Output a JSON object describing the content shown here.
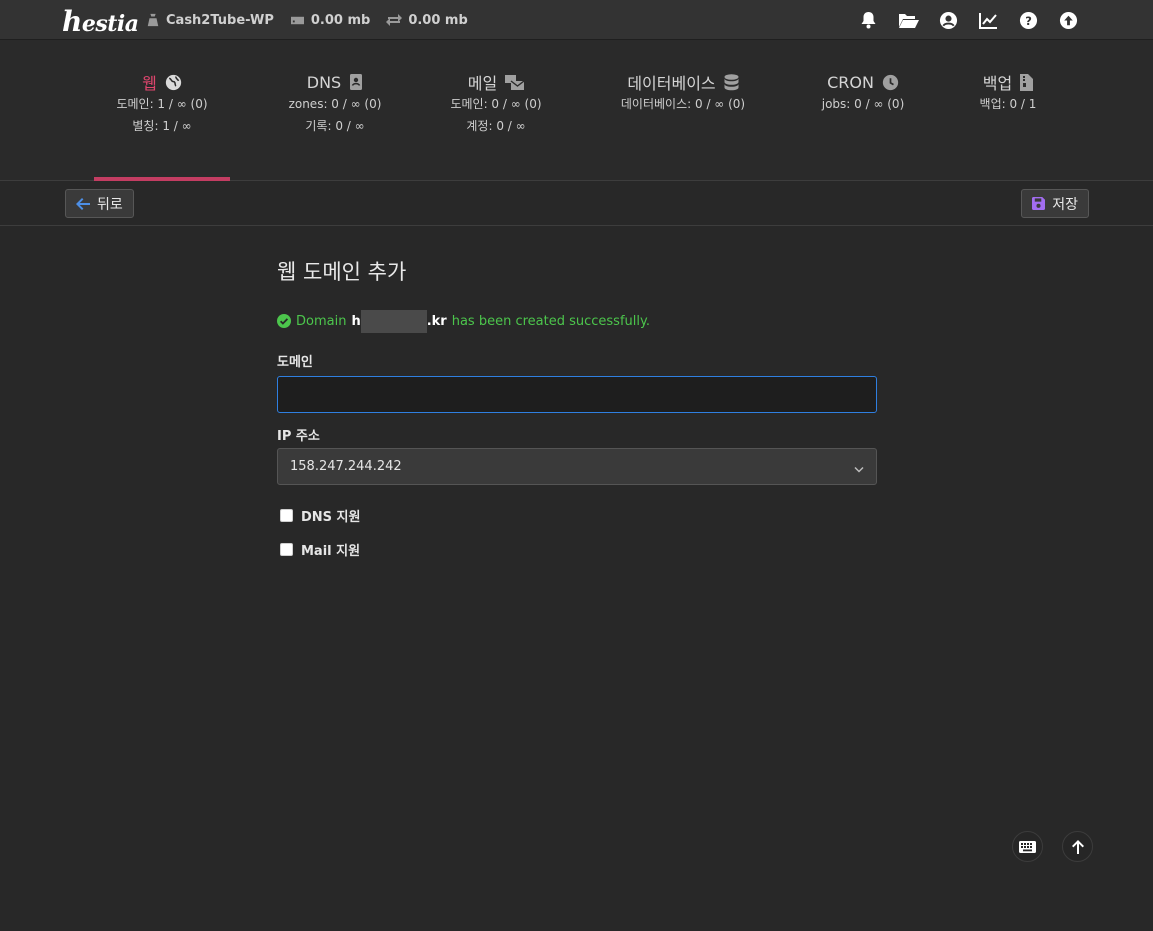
{
  "topbar": {
    "logo_text_initial": "h",
    "logo_text_rest": "estia",
    "user": "Cash2Tube-WP",
    "disk": "0.00 mb",
    "bandwidth": "0.00 mb",
    "icons": [
      "bell-icon",
      "folder-open-icon",
      "user-circle-icon",
      "chart-line-icon",
      "question-circle-icon",
      "arrow-up-circle-icon"
    ]
  },
  "tabs": [
    {
      "title": "웹",
      "icon": "globe-icon",
      "lines": [
        "도메인: 1 / ∞ (0)",
        "별칭: 1 / ∞"
      ],
      "active": true
    },
    {
      "title": "DNS",
      "icon": "address-book-icon",
      "lines": [
        "zones: 0 / ∞ (0)",
        "기록: 0 / ∞"
      ],
      "active": false
    },
    {
      "title": "메일",
      "icon": "mail-bulk-icon",
      "lines": [
        "도메인: 0 / ∞ (0)",
        "계정: 0 / ∞"
      ],
      "active": false
    },
    {
      "title": "데이터베이스",
      "icon": "database-icon",
      "lines": [
        "데이터베이스: 0 / ∞ (0)"
      ],
      "active": false
    },
    {
      "title": "CRON",
      "icon": "clock-icon",
      "lines": [
        "jobs: 0 / ∞ (0)"
      ],
      "active": false
    },
    {
      "title": "백업",
      "icon": "file-archive-icon",
      "lines": [
        "백업: 0 / 1"
      ],
      "active": false
    }
  ],
  "toolbar": {
    "back_label": "뒤로",
    "save_label": "저장"
  },
  "form": {
    "title": "웹 도메인 추가",
    "alert": {
      "prefix": "Domain",
      "domain_start": "h",
      "domain_end": ".kr",
      "suffix": "has been created successfully."
    },
    "domain_label": "도메인",
    "domain_value": "",
    "ip_label": "IP 주소",
    "ip_value": "158.247.244.242",
    "dns_support_label": "DNS 지원",
    "mail_support_label": "Mail 지원",
    "dns_checked": false,
    "mail_checked": false
  },
  "colors": {
    "accent": "#c33d62",
    "active_tab_text": "#e0466e",
    "success": "#4cc54c",
    "input_focus": "#2f7fe0",
    "background": "#282828"
  }
}
